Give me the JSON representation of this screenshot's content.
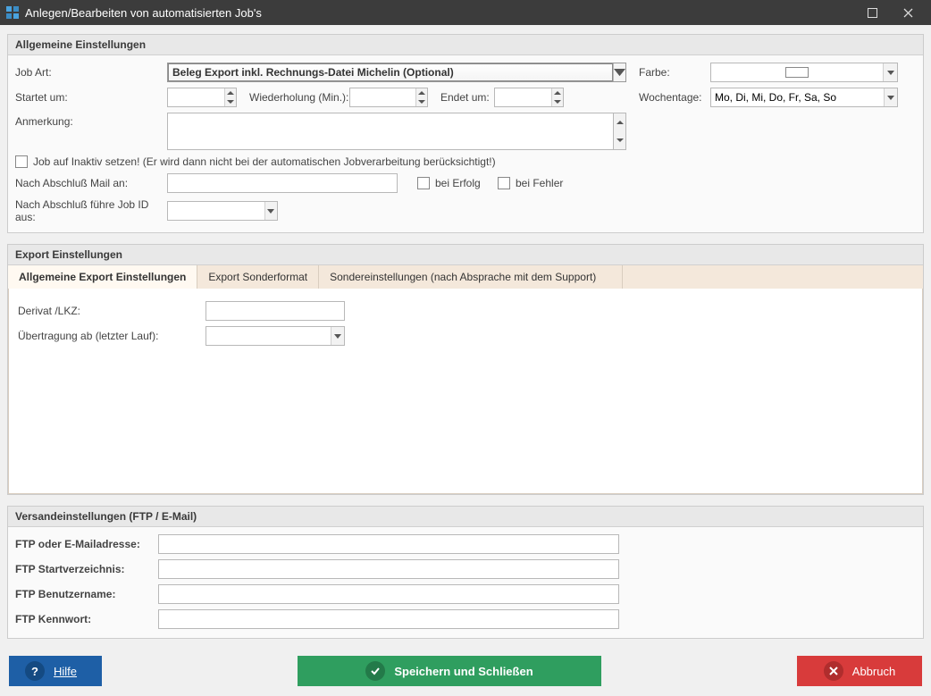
{
  "window": {
    "title": "Anlegen/Bearbeiten von automatisierten Job's"
  },
  "general": {
    "header": "Allgemeine Einstellungen",
    "jobArtLabel": "Job Art:",
    "jobArtValue": "Beleg Export inkl. Rechnungs-Datei Michelin (Optional)",
    "farbeLabel": "Farbe:",
    "startLabel": "Startet um:",
    "wiederholungLabel": "Wiederholung (Min.):",
    "endetLabel": "Endet um:",
    "wochentageLabel": "Wochentage:",
    "wochentageValue": "Mo, Di, Mi, Do, Fr, Sa, So",
    "anmerkungLabel": "Anmerkung:",
    "inaktivLabel": "Job auf Inaktiv setzen! (Er wird dann nicht bei der automatischen Jobverarbeitung berücksichtigt!)",
    "mailLabel": "Nach Abschluß Mail an:",
    "beiErfolgLabel": "bei Erfolg",
    "beiFehlerLabel": "bei Fehler",
    "fuehreJobLabel": "Nach Abschluß führe Job ID aus:"
  },
  "export": {
    "header": "Export Einstellungen",
    "tab1": "Allgemeine Export Einstellungen",
    "tab2": "Export Sonderformat",
    "tab3": "Sondereinstellungen (nach Absprache mit dem Support)",
    "derivatLabel": "Derivat /LKZ:",
    "uebertragungLabel": "Übertragung ab (letzter Lauf):"
  },
  "versand": {
    "header": "Versandeinstellungen (FTP / E-Mail)",
    "ftpMailLabel": "FTP oder E-Mailadresse:",
    "ftpStartLabel": "FTP Startverzeichnis:",
    "ftpUserLabel": "FTP Benutzername:",
    "ftpPassLabel": "FTP Kennwort:"
  },
  "footer": {
    "help": "Hilfe",
    "save": "Speichern und Schließen",
    "cancel": "Abbruch"
  }
}
